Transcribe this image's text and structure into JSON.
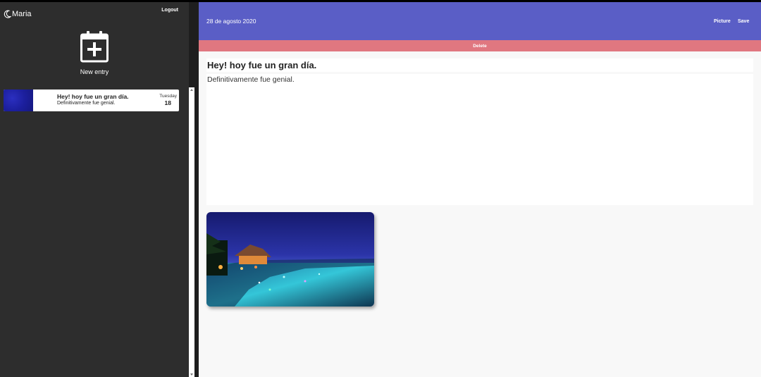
{
  "sidebar": {
    "user_name": "Maria",
    "logout_label": "Logout",
    "new_entry_label": "New entry",
    "entries": [
      {
        "title": "Hey! hoy fue un gran día.",
        "preview": "Definitivamente fue genial.",
        "weekday": "Tuesday",
        "day": "18"
      }
    ]
  },
  "header": {
    "date": "28 de agosto 2020",
    "picture_label": "Picture",
    "save_label": "Save",
    "delete_label": "Delete"
  },
  "entry": {
    "title": "Hey! hoy fue un gran día.",
    "body": "Definitivamente fue genial."
  },
  "colors": {
    "sidebar_bg": "#2d2d2d",
    "header_bg": "#5a5ec6",
    "delete_bg": "#e07780",
    "main_bg": "#f8f8f8"
  },
  "icons": {
    "user": "moon-icon",
    "new_entry": "calendar-plus-icon"
  }
}
